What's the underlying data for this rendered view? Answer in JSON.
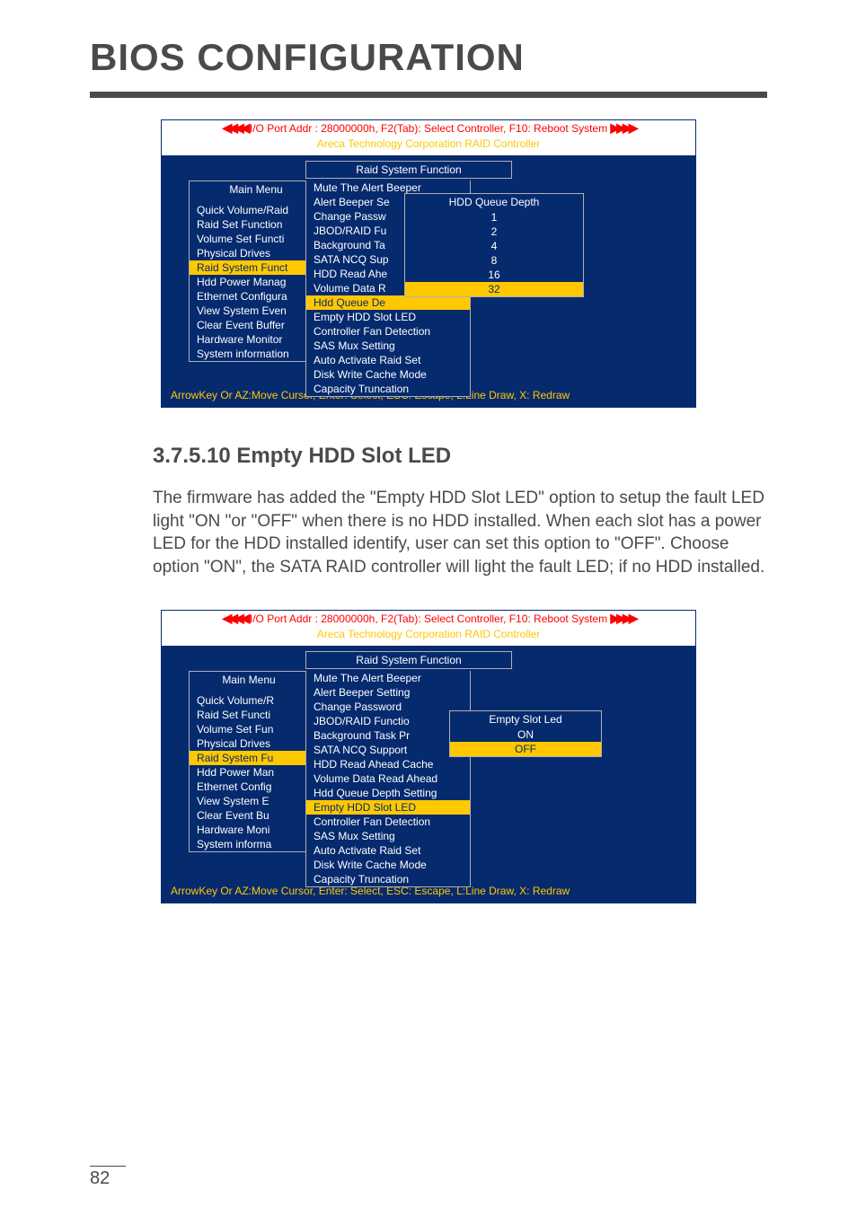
{
  "page_title": "BIOS CONFIGURATION",
  "page_number": "82",
  "section": {
    "number": "3.7.5.10",
    "title": "Empty HDD Slot LED",
    "body": "The firmware has added the \"Empty HDD Slot LED\" option to setup the fault LED light \"ON \"or \"OFF\" when there is no HDD installed. When each slot has a power LED for the HDD installed identify, user can set this option to \"OFF\". Choose option \"ON\", the SATA RAID controller will light the fault LED; if no HDD installed."
  },
  "bios_common": {
    "header": "I/O Port Addr : 28000000h, F2(Tab): Select Controller, F10: Reboot System",
    "subheader": "Areca Technology Corporation RAID Controller",
    "footer": "ArrowKey Or AZ:Move Cursor, Enter: Select, ESC: Escape, L:Line Draw, X: Redraw",
    "raid_func_title": "Raid System Function",
    "main_menu_title": "Main Menu"
  },
  "bios1": {
    "menu": [
      "Quick Volume/Raid",
      "Raid Set Function",
      "Volume Set Functi",
      "Physical Drives",
      "Raid System Funct",
      "Hdd Power Manag",
      "Ethernet Configura",
      "View System Even",
      "Clear Event Buffer",
      "Hardware Monitor",
      "System information"
    ],
    "func": [
      "Mute The Alert Beeper",
      "Alert Beeper Se",
      "Change Passw",
      "JBOD/RAID Fu",
      "Background Ta",
      "SATA NCQ Sup",
      "HDD Read Ahe",
      "Volume Data R",
      "Hdd Queue De",
      "Empty HDD Slot LED",
      "Controller Fan Detection",
      "SAS Mux Setting",
      "Auto Activate Raid Set",
      "Disk Write Cache Mode",
      "Capacity Truncation"
    ],
    "popup_title": "HDD Queue Depth",
    "popup_items": [
      "1",
      "2",
      "4",
      "8",
      "16",
      "32"
    ]
  },
  "bios2": {
    "menu": [
      "Quick Volume/R",
      "Raid Set Functi",
      "Volume Set Fun",
      "Physical Drives",
      "Raid System Fu",
      "Hdd Power Man",
      "Ethernet Config",
      "View System E",
      "Clear Event Bu",
      "Hardware Moni",
      "System informa"
    ],
    "func": [
      "Mute The Alert Beeper",
      "Alert Beeper Setting",
      "Change Password",
      "JBOD/RAID Functio",
      "Background Task Pr",
      "SATA NCQ Support",
      "HDD Read Ahead Cache",
      "Volume Data Read Ahead",
      "Hdd Queue Depth Setting",
      "Empty HDD Slot LED",
      "Controller Fan Detection",
      "SAS Mux Setting",
      "Auto Activate Raid Set",
      "Disk Write Cache Mode",
      "Capacity Truncation"
    ],
    "popup_title": "Empty Slot Led",
    "popup_items": [
      "ON",
      "OFF"
    ]
  }
}
